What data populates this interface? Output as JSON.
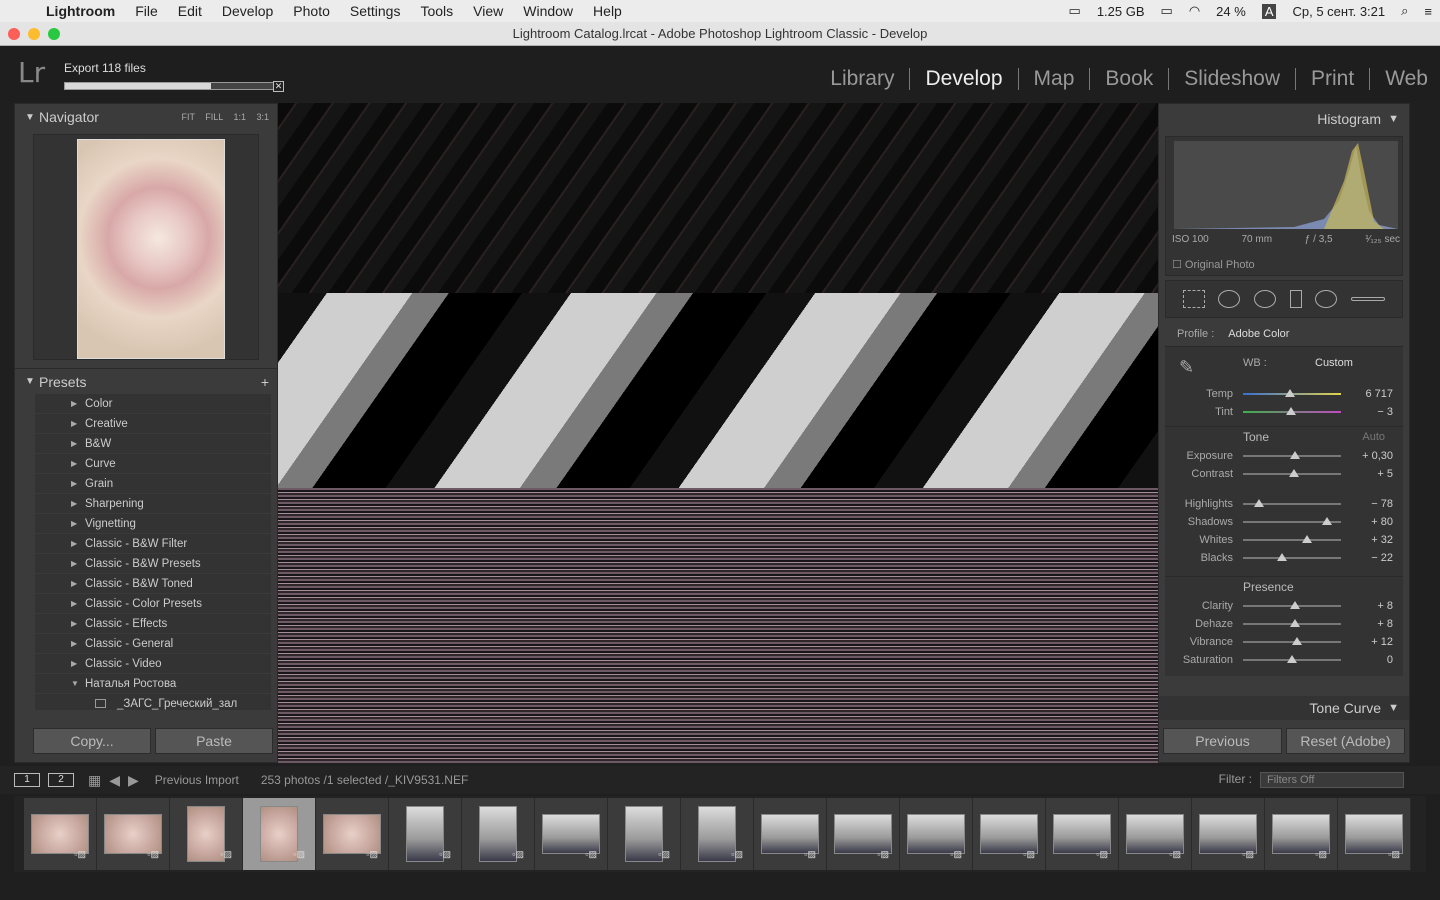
{
  "menubar": {
    "app": "Lightroom",
    "items": [
      "File",
      "Edit",
      "Develop",
      "Photo",
      "Settings",
      "Tools",
      "View",
      "Window",
      "Help"
    ],
    "memory": "1.25 GB",
    "battery": "24 %",
    "input": "A",
    "datetime": "Ср, 5 сент.  3:21"
  },
  "window": {
    "title": "Lightroom Catalog.lrcat - Adobe Photoshop Lightroom Classic - Develop"
  },
  "idplate": {
    "logo": "Lr",
    "export_text": "Export 118 files",
    "export_progress": 0.7
  },
  "modules": [
    "Library",
    "Develop",
    "Map",
    "Book",
    "Slideshow",
    "Print",
    "Web"
  ],
  "navigator": {
    "title": "Navigator",
    "options": "FIT FILL 1:1 3:1"
  },
  "presets": {
    "title": "Presets",
    "add": "+",
    "items": [
      "Color",
      "Creative",
      "B&W",
      "Curve",
      "Grain",
      "Sharpening",
      "Vignetting",
      "Classic - B&W Filter",
      "Classic - B&W Presets",
      "Classic - B&W Toned",
      "Classic - Color Presets",
      "Classic - Effects",
      "Classic - General",
      "Classic - Video",
      "Наталья Ростова"
    ],
    "child": "_ЗАГС_Греческий_зал"
  },
  "buttons": {
    "copy": "Copy...",
    "paste": "Paste",
    "previous": "Previous",
    "reset": "Reset (Adobe)"
  },
  "histogram": {
    "title": "Histogram",
    "iso": "ISO 100",
    "focal": "70 mm",
    "aperture": "ƒ / 3,5",
    "shutter": "¹⁄₁₂₅ sec",
    "original": "Original Photo"
  },
  "basic": {
    "profile_label": "Profile :",
    "profile": "Adobe Color",
    "wb_label": "WB :",
    "wb": "Custom",
    "temp": {
      "label": "Temp",
      "value": "6 717",
      "pos": 0.48
    },
    "tint": {
      "label": "Tint",
      "value": "− 3",
      "pos": 0.49
    },
    "tone_label": "Tone",
    "auto": "Auto",
    "exposure": {
      "label": "Exposure",
      "value": "+ 0,30",
      "pos": 0.53
    },
    "contrast": {
      "label": "Contrast",
      "value": "+ 5",
      "pos": 0.52
    },
    "highlights": {
      "label": "Highlights",
      "value": "− 78",
      "pos": 0.16
    },
    "shadows": {
      "label": "Shadows",
      "value": "+ 80",
      "pos": 0.86
    },
    "whites": {
      "label": "Whites",
      "value": "+ 32",
      "pos": 0.65
    },
    "blacks": {
      "label": "Blacks",
      "value": "− 22",
      "pos": 0.4
    },
    "presence_label": "Presence",
    "clarity": {
      "label": "Clarity",
      "value": "+ 8",
      "pos": 0.53
    },
    "dehaze": {
      "label": "Dehaze",
      "value": "+ 8",
      "pos": 0.53
    },
    "vibrance": {
      "label": "Vibrance",
      "value": "+ 12",
      "pos": 0.55
    },
    "saturation": {
      "label": "Saturation",
      "value": "0",
      "pos": 0.5
    }
  },
  "tone_curve": "Tone Curve",
  "filmbar": {
    "page1": "1",
    "page2": "2",
    "source": "Previous Import",
    "info": "253 photos /1 selected /_KIV9531.NEF",
    "filter_label": "Filter :",
    "filter_value": "Filters Off"
  },
  "colors": {
    "accent": "#3b3b3b",
    "dark": "#1f1f1f"
  }
}
